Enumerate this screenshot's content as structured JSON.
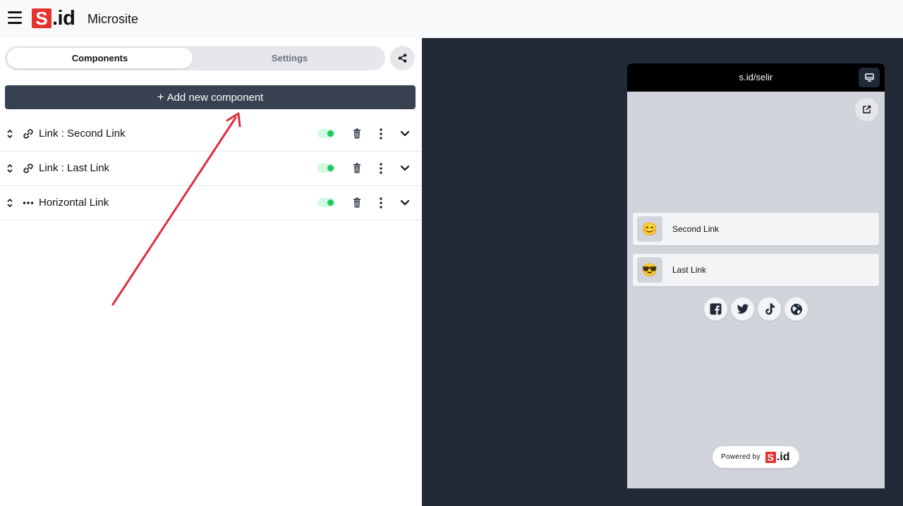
{
  "header": {
    "logo_s": "S",
    "logo_id": ".id",
    "title": "Microsite"
  },
  "tabs": {
    "components": "Components",
    "settings": "Settings"
  },
  "add_button": {
    "plus": "+",
    "label": "Add new component"
  },
  "components": [
    {
      "type_icon": "link-icon",
      "label": "Link : Second Link",
      "enabled": true
    },
    {
      "type_icon": "link-icon",
      "label": "Link : Last Link",
      "enabled": true
    },
    {
      "type_icon": "dots-horizontal-icon",
      "label": "Horizontal Link",
      "enabled": true
    }
  ],
  "preview": {
    "url": "s.id/selir",
    "links": [
      {
        "emoji": "😊",
        "label": "Second Link"
      },
      {
        "emoji": "😎",
        "label": "Last Link"
      }
    ],
    "socials": [
      "facebook-icon",
      "twitter-icon",
      "tiktok-icon",
      "globe-icon"
    ],
    "powered_by": "Powered by",
    "powered_logo_s": "S",
    "powered_logo_id": ".id"
  },
  "colors": {
    "brand_red": "#e5322d",
    "toggle_on": "#22c55e",
    "preview_bg": "#222a38",
    "add_button_bg": "#374151",
    "annotation_arrow": "#dc2f3c"
  }
}
